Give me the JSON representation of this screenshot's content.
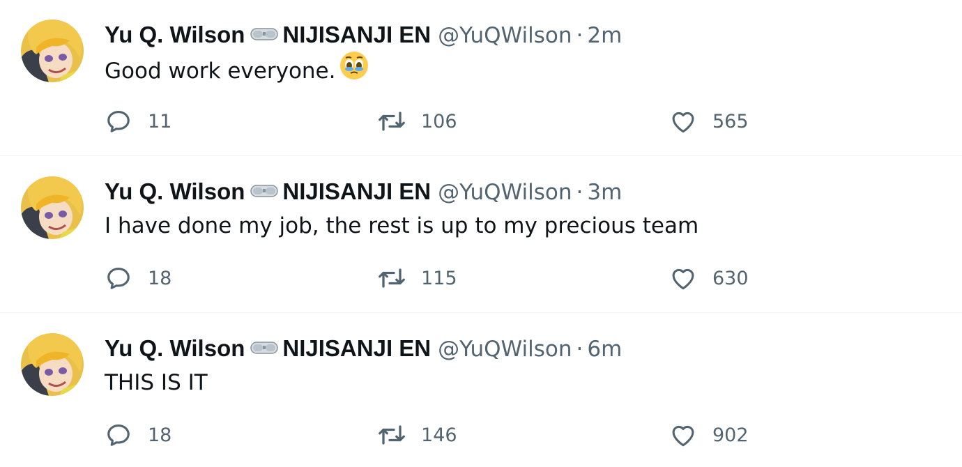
{
  "tweets": [
    {
      "author_name": "Yu Q. Wilson",
      "org": "NIJISANJI EN",
      "handle": "@YuQWilson",
      "separator": "·",
      "time": "2m",
      "text": "Good work everyone.",
      "emoji_icon": "holding-back-tears-emoji",
      "replies": "11",
      "retweets": "106",
      "likes": "565"
    },
    {
      "author_name": "Yu Q. Wilson",
      "org": "NIJISANJI EN",
      "handle": "@YuQWilson",
      "separator": "·",
      "time": "3m",
      "text": "I have done my job, the rest is up to my precious team",
      "replies": "18",
      "retweets": "115",
      "likes": "630"
    },
    {
      "author_name": "Yu Q. Wilson",
      "org": "NIJISANJI EN",
      "handle": "@YuQWilson",
      "separator": "·",
      "time": "6m",
      "text": "THIS IS IT",
      "replies": "18",
      "retweets": "146",
      "likes": "902"
    }
  ],
  "icons": {
    "reply": "reply-icon",
    "retweet": "retweet-icon",
    "like": "heart-icon",
    "name_badge": "goggles-icon"
  },
  "colors": {
    "text_primary": "#0f1419",
    "text_secondary": "#536471",
    "divider": "#eff3f4",
    "background": "#ffffff"
  }
}
